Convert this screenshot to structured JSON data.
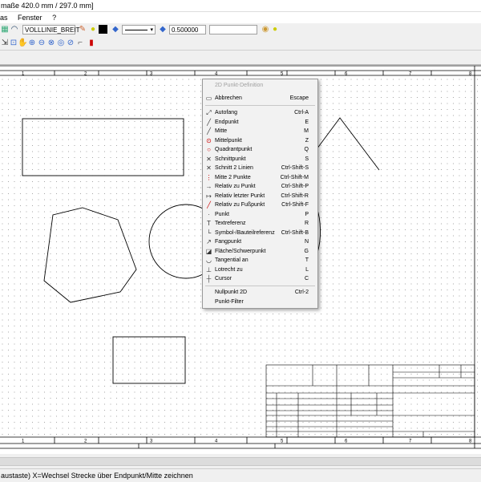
{
  "window": {
    "title_fragment": "maße 420.0 mm / 297.0 mm]"
  },
  "menu": [
    "as",
    "Fenster",
    "?"
  ],
  "toolbar": {
    "linetype": "VOLLLINIE_BREIT",
    "linewidth": "0.500000",
    "extra_field": ""
  },
  "ruler": {
    "top_numbers": [
      "1",
      "2",
      "3",
      "4",
      "5",
      "6",
      "7",
      "8"
    ],
    "bottom_numbers": [
      "1",
      "2",
      "3",
      "4",
      "5",
      "6",
      "7",
      "8"
    ]
  },
  "context_menu": {
    "title": "2D Punkt-Definition",
    "cancel": {
      "label": "Abbrechen",
      "shortcut": "Escape"
    },
    "items": [
      {
        "icon": "autofang-icon",
        "label": "Autofang",
        "shortcut": "Ctrl-A"
      },
      {
        "icon": "endpoint-icon",
        "label": "Endpunkt",
        "shortcut": "E"
      },
      {
        "icon": "midpoint-icon",
        "label": "Mitte",
        "shortcut": "M"
      },
      {
        "icon": "center-icon",
        "label": "Mittelpunkt",
        "shortcut": "Z"
      },
      {
        "icon": "quadrant-icon",
        "label": "Quadrantpunkt",
        "shortcut": "Q"
      },
      {
        "icon": "intersection-icon",
        "label": "Schnittpunkt",
        "shortcut": "S"
      },
      {
        "icon": "intersection2-icon",
        "label": "Schnitt 2 Linien",
        "shortcut": "Ctrl-Shift-S"
      },
      {
        "icon": "mid2-icon",
        "label": "Mitte 2 Punkte",
        "shortcut": "Ctrl-Shift-M"
      },
      {
        "icon": "relative-point-icon",
        "label": "Relativ zu Punkt",
        "shortcut": "Ctrl-Shift-P"
      },
      {
        "icon": "relative-last-icon",
        "label": "Relativ letzter Punkt",
        "shortcut": "Ctrl-Shift-R"
      },
      {
        "icon": "relative-foot-icon",
        "label": "Relativ zu Fußpunkt",
        "shortcut": "Ctrl-Shift-F"
      },
      {
        "icon": "point-icon",
        "label": "Punkt",
        "shortcut": "P"
      },
      {
        "icon": "text-ref-icon",
        "label": "Textreferenz",
        "shortcut": "R"
      },
      {
        "icon": "symbol-ref-icon",
        "label": "Symbol-/Bauteilreferenz",
        "shortcut": "Ctrl-Shift-B"
      },
      {
        "icon": "snap-icon",
        "label": "Fangpunkt",
        "shortcut": "N"
      },
      {
        "icon": "area-icon",
        "label": "Fläche/Schwerpunkt",
        "shortcut": "G"
      },
      {
        "icon": "tangent-icon",
        "label": "Tangential an",
        "shortcut": "T"
      },
      {
        "icon": "perpendicular-icon",
        "label": "Lotrecht zu",
        "shortcut": "L"
      },
      {
        "icon": "cursor-icon",
        "label": "Cursor",
        "shortcut": "C"
      }
    ],
    "footer": [
      {
        "label": "Nullpunkt 2D",
        "shortcut": "Ctrl-2"
      },
      {
        "label": "Punkt-Filter",
        "shortcut": ""
      }
    ]
  },
  "statusbar": {
    "text": "austaste) X=Wechsel Strecke über Endpunkt/Mitte zeichnen"
  }
}
